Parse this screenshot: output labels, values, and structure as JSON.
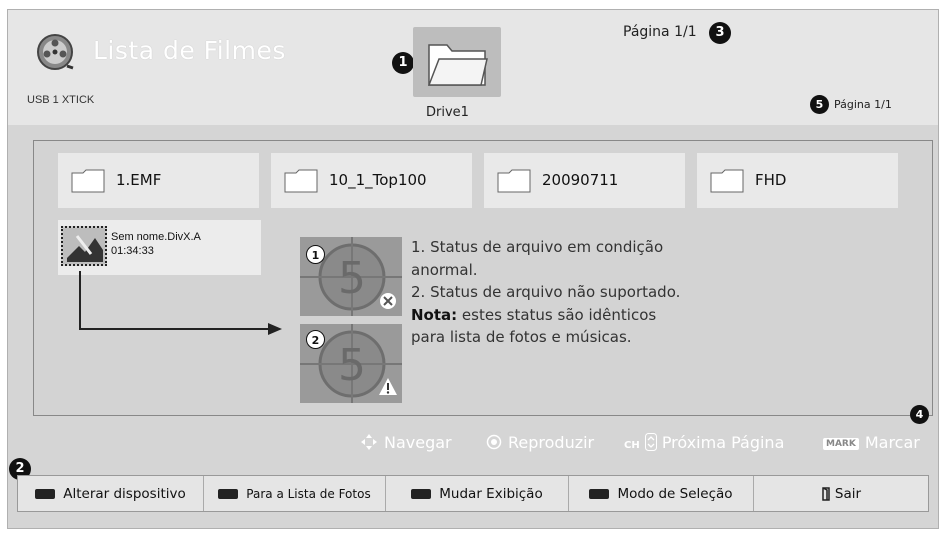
{
  "header": {
    "title": "Lista de Filmes",
    "device": "USB 1 XTICK",
    "drive_label": "Drive1",
    "page_top": "Página 1/1",
    "page_right": "Página 1/1"
  },
  "callouts": [
    "1",
    "2",
    "3",
    "4",
    "5"
  ],
  "folders": [
    {
      "label": "1.EMF"
    },
    {
      "label": "10_1_Top100"
    },
    {
      "label": "20090711"
    },
    {
      "label": "FHD"
    }
  ],
  "file": {
    "name": "Sem nome.DivX.A",
    "duration": "01:34:33"
  },
  "status_badges": [
    "1",
    "2"
  ],
  "explanation": {
    "line1": "1. Status de arquivo em condição anormal.",
    "line2": "2. Status de arquivo não suportado.",
    "note_label": "Nota:",
    "note_text": " estes status são idênticos para lista de fotos e músicas."
  },
  "nav": {
    "navigate": "Navegar",
    "play": "Reproduzir",
    "ch_icon": "CH",
    "next_page": "Próxima Página",
    "mark_badge": "MARK",
    "mark": "Marcar"
  },
  "buttons": [
    {
      "label": "Alterar dispositivo",
      "color": "#222222"
    },
    {
      "label": "Para a Lista de Fotos",
      "color": "#222222"
    },
    {
      "label": "Mudar Exibição",
      "color": "#222222"
    },
    {
      "label": "Modo de Seleção",
      "color": "#222222"
    },
    {
      "label": "Sair",
      "icon": "exit-icon"
    }
  ]
}
